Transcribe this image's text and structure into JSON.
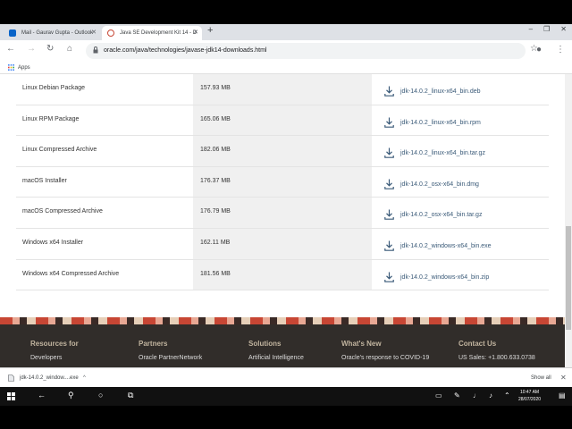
{
  "browser": {
    "tabs": [
      {
        "title": "Mail - Gaurav Gupta - Outlook",
        "favicon_color": "#0a64c8"
      },
      {
        "title": "Java SE Development Kit 14 - D",
        "favicon_color": "#c74634"
      }
    ],
    "new_tab_symbol": "+",
    "window_controls": [
      "–",
      "❐",
      "✕"
    ],
    "url": "oracle.com/java/technologies/javase-jdk14-downloads.html",
    "bookmarks": {
      "apps_label": "Apps"
    }
  },
  "downloads": [
    {
      "product": "Linux Debian Package",
      "size": "157.93 MB",
      "file": "jdk-14.0.2_linux-x64_bin.deb"
    },
    {
      "product": "Linux RPM Package",
      "size": "165.06 MB",
      "file": "jdk-14.0.2_linux-x64_bin.rpm"
    },
    {
      "product": "Linux Compressed Archive",
      "size": "182.06 MB",
      "file": "jdk-14.0.2_linux-x64_bin.tar.gz"
    },
    {
      "product": "macOS Installer",
      "size": "176.37 MB",
      "file": "jdk-14.0.2_osx-x64_bin.dmg"
    },
    {
      "product": "macOS Compressed Archive",
      "size": "176.79 MB",
      "file": "jdk-14.0.2_osx-x64_bin.tar.gz"
    },
    {
      "product": "Windows x64 Installer",
      "size": "162.11 MB",
      "file": "jdk-14.0.2_windows-x64_bin.exe"
    },
    {
      "product": "Windows x64 Compressed Archive",
      "size": "181.56 MB",
      "file": "jdk-14.0.2_windows-x64_bin.zip"
    }
  ],
  "footer": [
    {
      "heading": "Resources for",
      "item": "Developers"
    },
    {
      "heading": "Partners",
      "item": "Oracle PartnerNetwork"
    },
    {
      "heading": "Solutions",
      "item": "Artificial Intelligence"
    },
    {
      "heading": "What's New",
      "item": "Oracle's response to COVID-19"
    },
    {
      "heading": "Contact Us",
      "item": "US Sales: +1.800.633.0738"
    }
  ],
  "download_shelf": {
    "file": "jdk-14.0.2_window....exe",
    "show_all": "Show all"
  },
  "taskbar": {
    "time": "10:47 AM",
    "date": "28/07/2020"
  },
  "colors": {
    "oracle_red": "#c74634",
    "footer_bg": "#312d2a",
    "link": "#3a5a78"
  }
}
